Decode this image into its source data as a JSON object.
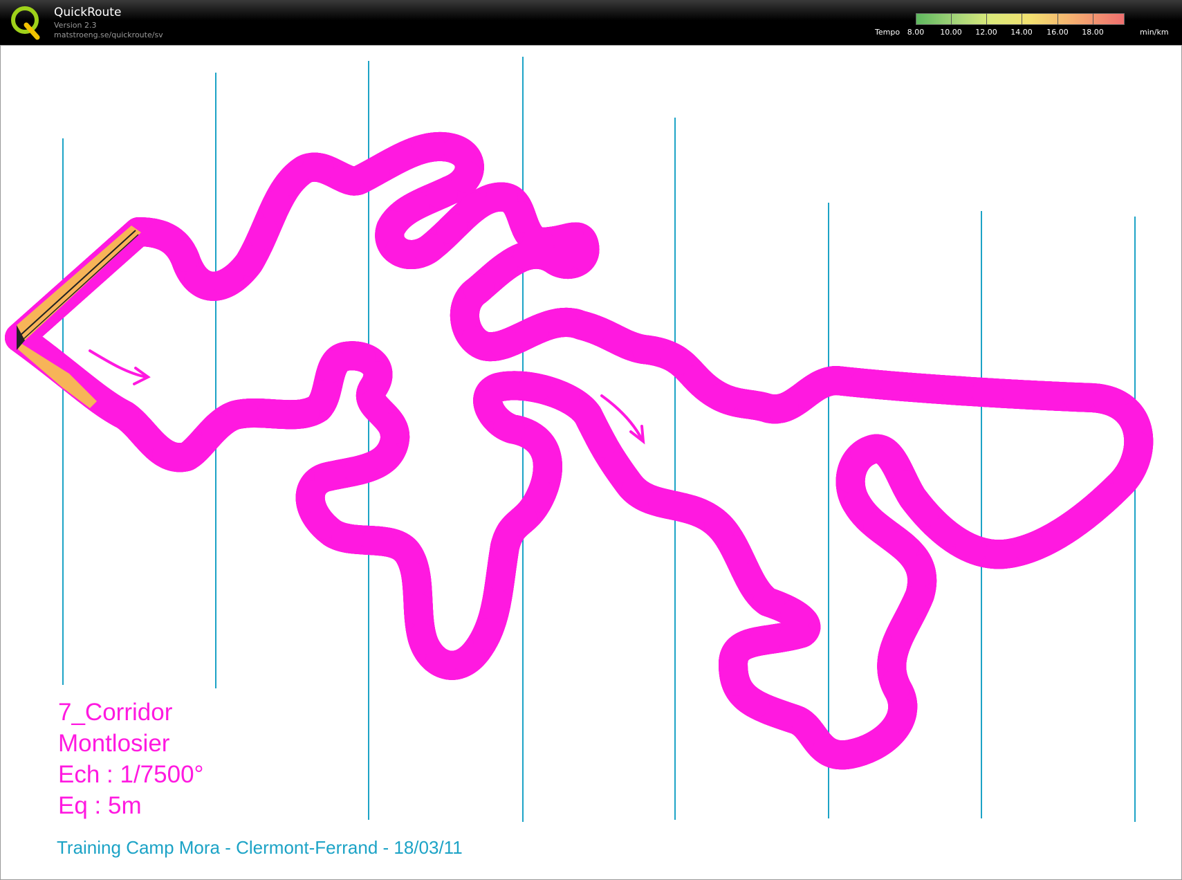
{
  "app": {
    "title": "QuickRoute",
    "version": "Version 2.3",
    "url": "matstroeng.se/quickroute/sv",
    "logo_letter": "Q"
  },
  "legend": {
    "label": "Tempo",
    "unit": "min/km",
    "ticks": [
      "8.00",
      "10.00",
      "12.00",
      "14.00",
      "16.00",
      "18.00"
    ],
    "colors": {
      "fast": "#5fb85f",
      "mid": "#f2e070",
      "slow": "#ef6f6f"
    }
  },
  "map": {
    "corridor_color": "#ff19e0",
    "terrain_colors": {
      "open": "#cfe9c0",
      "forest": "#7ccf5f",
      "contour": "#c4743c",
      "path": "#222222"
    },
    "meridian_color": "#1ca3c6",
    "arrow_icon": "direction-arrow-icon"
  },
  "course_info": {
    "name": "7_Corridor",
    "place": "Montlosier",
    "scale": "Ech : 1/7500°",
    "equidistance": "Eq : 5m"
  },
  "footer": "Training Camp Mora - Clermont-Ferrand - 18/03/11"
}
